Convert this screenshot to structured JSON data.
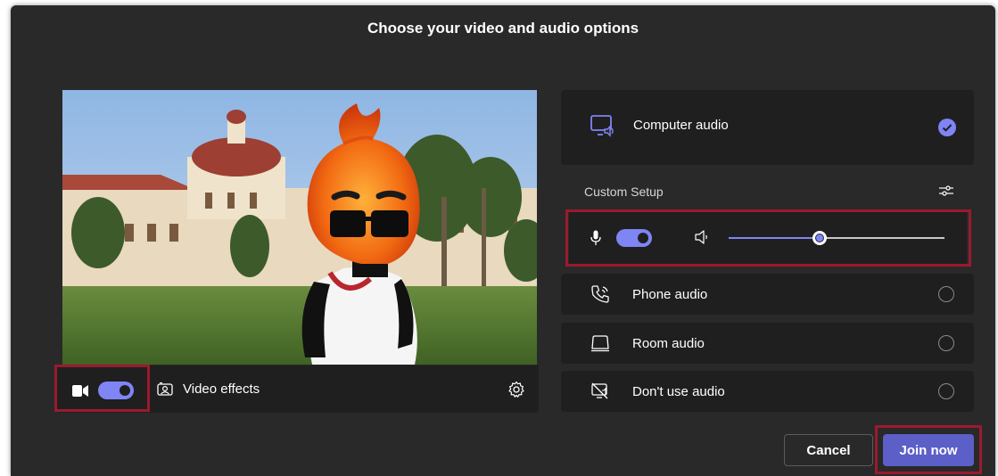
{
  "dialog": {
    "title": "Choose your video and audio options"
  },
  "video": {
    "camera_on": true,
    "effects_label": "Video effects",
    "icons": {
      "camera": "camera-icon",
      "effects": "video-effects-icon",
      "settings": "gear-icon"
    }
  },
  "audio": {
    "computer_audio": {
      "label": "Computer audio",
      "selected": true,
      "icon": "computer-audio-icon"
    },
    "custom_setup": {
      "label": "Custom Setup",
      "icon": "audio-settings-icon"
    },
    "mic_on": true,
    "speaker_volume_percent": 42,
    "options": [
      {
        "label": "Phone audio",
        "icon": "phone-audio-icon",
        "selected": false
      },
      {
        "label": "Room audio",
        "icon": "room-audio-icon",
        "selected": false
      },
      {
        "label": "Don't use audio",
        "icon": "no-audio-icon",
        "selected": false
      }
    ]
  },
  "actions": {
    "cancel_label": "Cancel",
    "join_label": "Join now"
  },
  "colors": {
    "dialog_bg": "#292929",
    "panel_bg": "#1f1f1f",
    "accent": "#7f85f5",
    "join_button": "#5b5fc7",
    "highlight": "#9b1a2f"
  }
}
